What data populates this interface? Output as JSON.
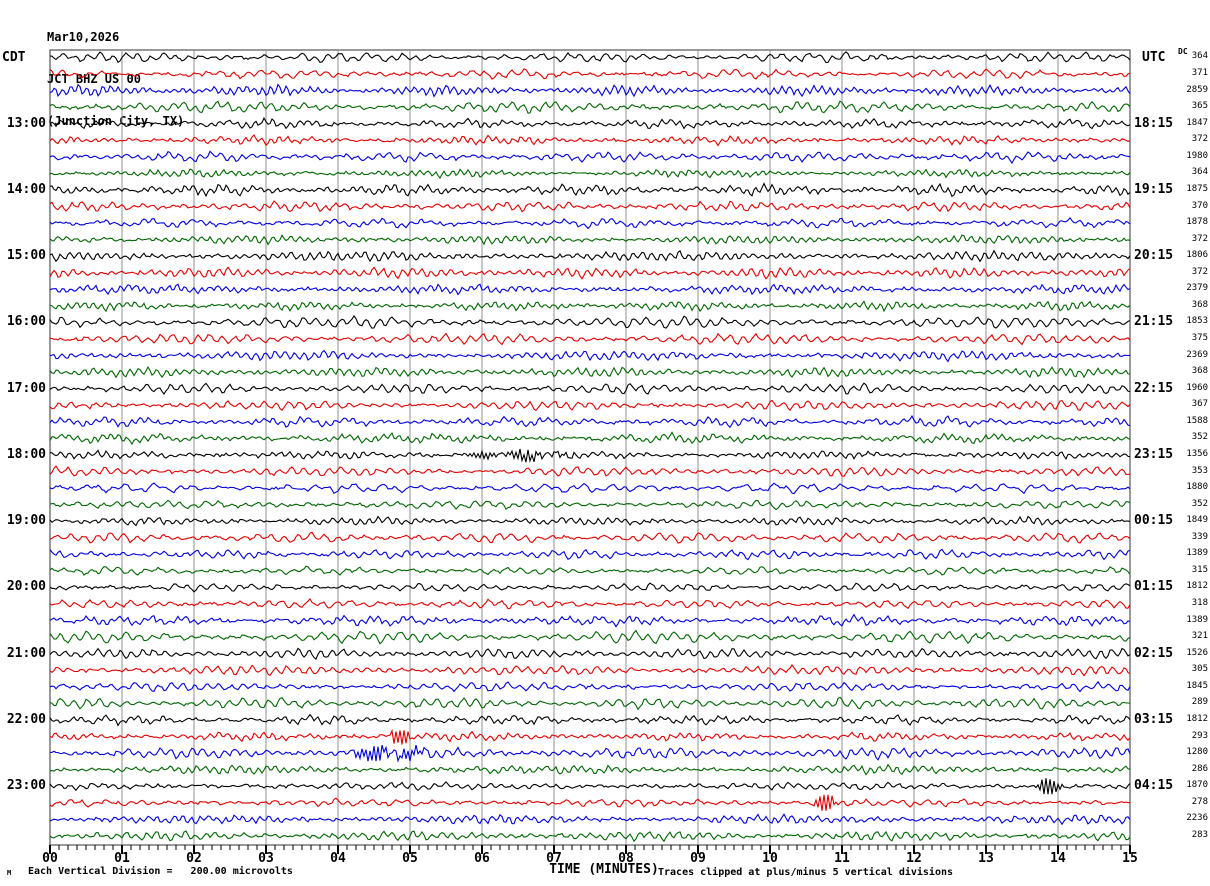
{
  "header": {
    "date": "Mar10,2026",
    "station": "JCT BHZ US 00",
    "location": "(Junction City, TX)"
  },
  "left_timezone_label": "CDT",
  "right_timezone_label": "UTC",
  "dc_column_label": "DC",
  "footer": {
    "scale_note": "Each Vertical Division =   200.00 microvolts",
    "x_axis_label": "TIME (MINUTES)",
    "clip_note": "Traces clipped at plus/minus 5 vertical divisions",
    "corner_mark": "M"
  },
  "chart_data": {
    "type": "line",
    "title": "Helicorder seismogram JCT BHZ US 00 (Junction City, TX) Mar10,2026",
    "xlabel": "TIME (MINUTES)",
    "x_range_minutes": [
      0,
      15
    ],
    "x_ticks": [
      "00",
      "01",
      "02",
      "03",
      "04",
      "05",
      "06",
      "07",
      "08",
      "09",
      "10",
      "11",
      "12",
      "13",
      "14",
      "15"
    ],
    "minor_ticks_per_major": 8,
    "minutes_per_row": 15,
    "grid": true,
    "grid_color": "#909090",
    "frame_color": "#333333",
    "trace_colors": {
      "black": "#000000",
      "red": "#e00000",
      "blue": "#0000dd",
      "green": "#006600"
    },
    "color_cycle": [
      "black",
      "red",
      "blue",
      "green"
    ],
    "rows": [
      {
        "dc": 364,
        "left": "",
        "right": ""
      },
      {
        "dc": 371,
        "left": "",
        "right": ""
      },
      {
        "dc": 2859,
        "left": "",
        "right": ""
      },
      {
        "dc": 365,
        "left": "",
        "right": ""
      },
      {
        "dc": 1847,
        "left": "13:00",
        "right": "18:15"
      },
      {
        "dc": 372,
        "left": "",
        "right": ""
      },
      {
        "dc": 1980,
        "left": "",
        "right": ""
      },
      {
        "dc": 364,
        "left": "",
        "right": ""
      },
      {
        "dc": 1875,
        "left": "14:00",
        "right": "19:15"
      },
      {
        "dc": 370,
        "left": "",
        "right": ""
      },
      {
        "dc": 1878,
        "left": "",
        "right": ""
      },
      {
        "dc": 372,
        "left": "",
        "right": ""
      },
      {
        "dc": 1806,
        "left": "15:00",
        "right": "20:15"
      },
      {
        "dc": 372,
        "left": "",
        "right": ""
      },
      {
        "dc": 2379,
        "left": "",
        "right": ""
      },
      {
        "dc": 368,
        "left": "",
        "right": ""
      },
      {
        "dc": 1853,
        "left": "16:00",
        "right": "21:15"
      },
      {
        "dc": 375,
        "left": "",
        "right": ""
      },
      {
        "dc": 2369,
        "left": "",
        "right": ""
      },
      {
        "dc": 368,
        "left": "",
        "right": ""
      },
      {
        "dc": 1960,
        "left": "17:00",
        "right": "22:15"
      },
      {
        "dc": 367,
        "left": "",
        "right": ""
      },
      {
        "dc": 1588,
        "left": "",
        "right": ""
      },
      {
        "dc": 352,
        "left": "",
        "right": ""
      },
      {
        "dc": 1356,
        "left": "18:00",
        "right": "23:15"
      },
      {
        "dc": 353,
        "left": "",
        "right": ""
      },
      {
        "dc": 1880,
        "left": "",
        "right": ""
      },
      {
        "dc": 352,
        "left": "",
        "right": ""
      },
      {
        "dc": 1849,
        "left": "19:00",
        "right": "00:15"
      },
      {
        "dc": 339,
        "left": "",
        "right": ""
      },
      {
        "dc": 1389,
        "left": "",
        "right": ""
      },
      {
        "dc": 315,
        "left": "",
        "right": ""
      },
      {
        "dc": 1812,
        "left": "20:00",
        "right": "01:15"
      },
      {
        "dc": 318,
        "left": "",
        "right": ""
      },
      {
        "dc": 1389,
        "left": "",
        "right": ""
      },
      {
        "dc": 321,
        "left": "",
        "right": ""
      },
      {
        "dc": 1526,
        "left": "21:00",
        "right": "02:15"
      },
      {
        "dc": 305,
        "left": "",
        "right": ""
      },
      {
        "dc": 1845,
        "left": "",
        "right": ""
      },
      {
        "dc": 289,
        "left": "",
        "right": ""
      },
      {
        "dc": 1812,
        "left": "22:00",
        "right": "03:15"
      },
      {
        "dc": 293,
        "left": "",
        "right": ""
      },
      {
        "dc": 1280,
        "left": "",
        "right": ""
      },
      {
        "dc": 286,
        "left": "",
        "right": ""
      },
      {
        "dc": 1870,
        "left": "23:00",
        "right": "04:15"
      },
      {
        "dc": 278,
        "left": "",
        "right": ""
      },
      {
        "dc": 2236,
        "left": "",
        "right": ""
      },
      {
        "dc": 283,
        "left": "",
        "right": ""
      }
    ],
    "events": [
      {
        "row": 24,
        "minute_start": 5.6,
        "minute_end": 7.4,
        "amplitude": 4.5
      },
      {
        "row": 41,
        "minute_start": 4.7,
        "minute_end": 5.05,
        "amplitude": 10
      },
      {
        "row": 42,
        "minute_start": 3.9,
        "minute_end": 5.4,
        "amplitude": 7
      },
      {
        "row": 44,
        "minute_start": 13.65,
        "minute_end": 14.15,
        "amplitude": 10
      },
      {
        "row": 45,
        "minute_start": 10.55,
        "minute_end": 10.95,
        "amplitude": 11
      }
    ]
  }
}
